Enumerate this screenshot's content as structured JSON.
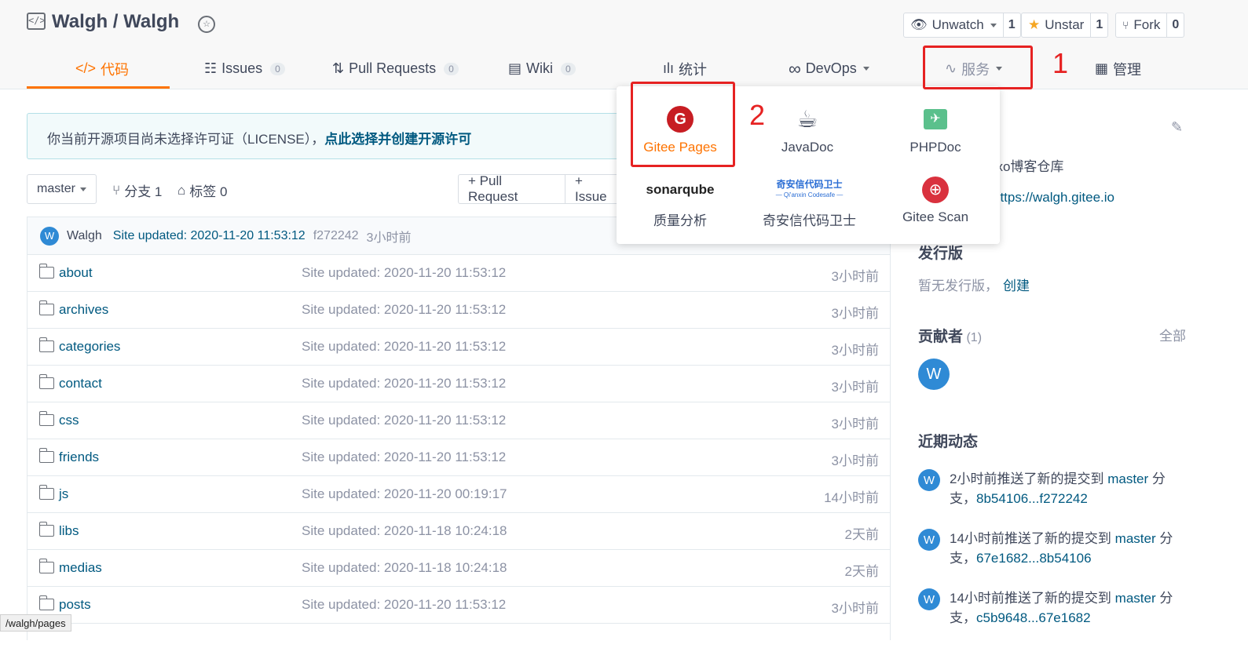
{
  "repo": {
    "title": "Walgh / Walgh",
    "unwatch_label": "Unwatch",
    "unwatch_count": "1",
    "unstar_label": "Unstar",
    "unstar_count": "1",
    "fork_label": "Fork",
    "fork_count": "0"
  },
  "tabs": [
    {
      "label": "代码",
      "icon": "code-icon"
    },
    {
      "label": "Issues",
      "count": "0",
      "icon": "issues-icon"
    },
    {
      "label": "Pull Requests",
      "count": "0",
      "icon": "pr-icon"
    },
    {
      "label": "Wiki",
      "count": "0",
      "icon": "wiki-icon"
    },
    {
      "label": "统计",
      "icon": "chart-icon"
    },
    {
      "label": "DevOps",
      "icon": "infinity-icon"
    },
    {
      "label": "服务",
      "icon": "pulse-icon"
    },
    {
      "label": "管理",
      "icon": "manage-icon"
    }
  ],
  "annotations": {
    "one": "1",
    "two": "2"
  },
  "notice": {
    "text": "你当前开源项目尚未选择许可证（LICENSE），",
    "link": "点此选择并创建开源许可"
  },
  "toolbar": {
    "branch": "master",
    "branches": "分支 1",
    "tags": "标签 0",
    "pull_request": "+ Pull Request",
    "issue": "+ Issue"
  },
  "commit": {
    "avatar": "W",
    "author": "Walgh",
    "message": "Site updated: 2020-11-20 11:53:12",
    "hash": "f272242",
    "time": "3小时前"
  },
  "files": [
    {
      "name": "about",
      "msg": "Site updated: 2020-11-20 11:53:12",
      "time": "3小时前"
    },
    {
      "name": "archives",
      "msg": "Site updated: 2020-11-20 11:53:12",
      "time": "3小时前"
    },
    {
      "name": "categories",
      "msg": "Site updated: 2020-11-20 11:53:12",
      "time": "3小时前"
    },
    {
      "name": "contact",
      "msg": "Site updated: 2020-11-20 11:53:12",
      "time": "3小时前"
    },
    {
      "name": "css",
      "msg": "Site updated: 2020-11-20 11:53:12",
      "time": "3小时前"
    },
    {
      "name": "friends",
      "msg": "Site updated: 2020-11-20 11:53:12",
      "time": "3小时前"
    },
    {
      "name": "js",
      "msg": "Site updated: 2020-11-20 00:19:17",
      "time": "14小时前"
    },
    {
      "name": "libs",
      "msg": "Site updated: 2020-11-18 10:24:18",
      "time": "2天前"
    },
    {
      "name": "medias",
      "msg": "Site updated: 2020-11-18 10:24:18",
      "time": "2天前"
    },
    {
      "name": "posts",
      "msg": "Site updated: 2020-11-20 11:53:12",
      "time": "3小时前"
    }
  ],
  "dropdown": [
    {
      "label": "Gitee Pages",
      "icon": "gitee-pages-icon"
    },
    {
      "label": "JavaDoc",
      "icon": "javadoc-icon"
    },
    {
      "label": "PHPDoc",
      "icon": "phpdoc-icon"
    },
    {
      "label": "质量分析",
      "icon": "sonarqube-icon",
      "logo_text": "sonarqube"
    },
    {
      "label": "奇安信代码卫士",
      "icon": "qianxin-icon",
      "logo_text": "奇安信代码卫士",
      "logo_sub": "— Qi'anxin Codesafe —"
    },
    {
      "label": "Gitee Scan",
      "icon": "gitee-scan-icon"
    }
  ],
  "sidebar": {
    "description": "exo博客仓库",
    "url": "https://walgh.gitee.io",
    "releases_title": "发行版",
    "releases_text": "暂无发行版，",
    "releases_create": "创建",
    "contributors_title": "贡献者",
    "contributors_count": "(1)",
    "contributors_all": "全部",
    "contributor_avatar": "W",
    "activity_title": "近期动态",
    "activities": [
      {
        "avatar": "W",
        "text": "2小时前推送了新的提交到",
        "branch": "master",
        "suffix": "分支，",
        "range": "8b54106...f272242"
      },
      {
        "avatar": "W",
        "text": "14小时前推送了新的提交到",
        "branch": "master",
        "suffix": "分支，",
        "range": "67e1682...8b54106"
      },
      {
        "avatar": "W",
        "text": "14小时前推送了新的提交到",
        "branch": "master",
        "suffix": "分支，",
        "range": "c5b9648...67e1682"
      }
    ]
  },
  "status_url": "/walgh/pages",
  "colors": {
    "accent": "#fe7300",
    "link": "#005980",
    "annotation_red": "#e62222",
    "avatar_blue": "#2f8ad5"
  }
}
